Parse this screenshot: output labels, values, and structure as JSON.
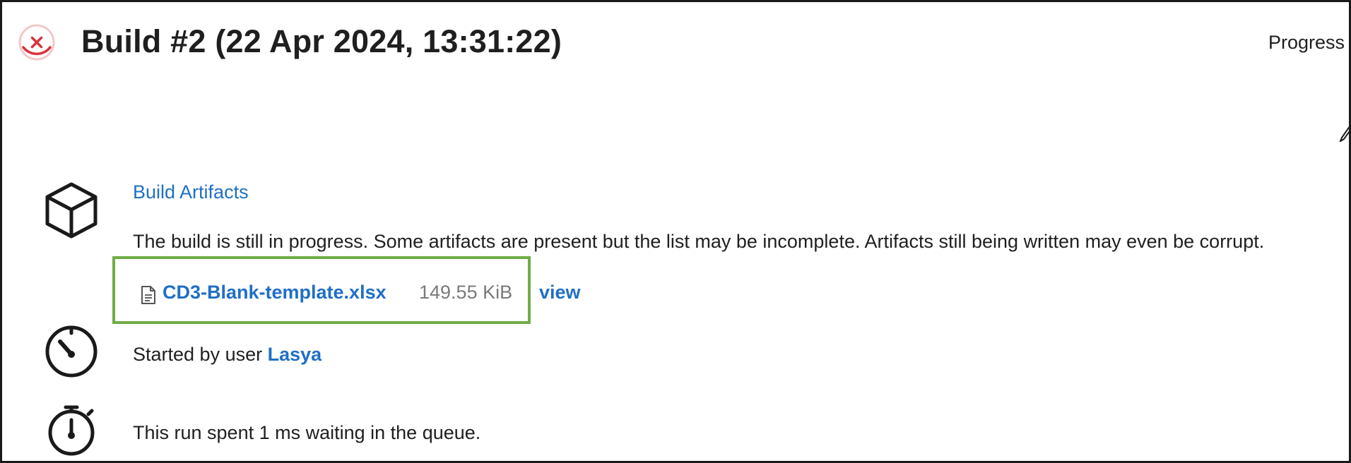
{
  "header": {
    "title": "Build #2 (22 Apr 2024, 13:31:22)",
    "status_icon": "failed-circle-x-icon",
    "right_label": "Progress"
  },
  "artifacts": {
    "heading": "Build Artifacts",
    "icon": "package-cube-icon",
    "note": "The build is still in progress. Some artifacts are present but the list may be incomplete. Artifacts still being written may even be corrupt.",
    "files": [
      {
        "name": "CD3-Blank-template.xlsx",
        "size": "149.55 KiB",
        "icon": "file-document-icon",
        "view_label": "view"
      }
    ],
    "highlight_color": "#70ad47"
  },
  "started": {
    "icon": "gauge-timer-icon",
    "prefix": "Started by user",
    "user": "Lasya"
  },
  "queue": {
    "icon": "stopwatch-icon",
    "text": "This run spent 1 ms waiting in the queue."
  },
  "colors": {
    "link": "#1f6fc5",
    "failure": "#d9333f",
    "text": "#1f1f1f",
    "muted": "#7a7a7a"
  }
}
